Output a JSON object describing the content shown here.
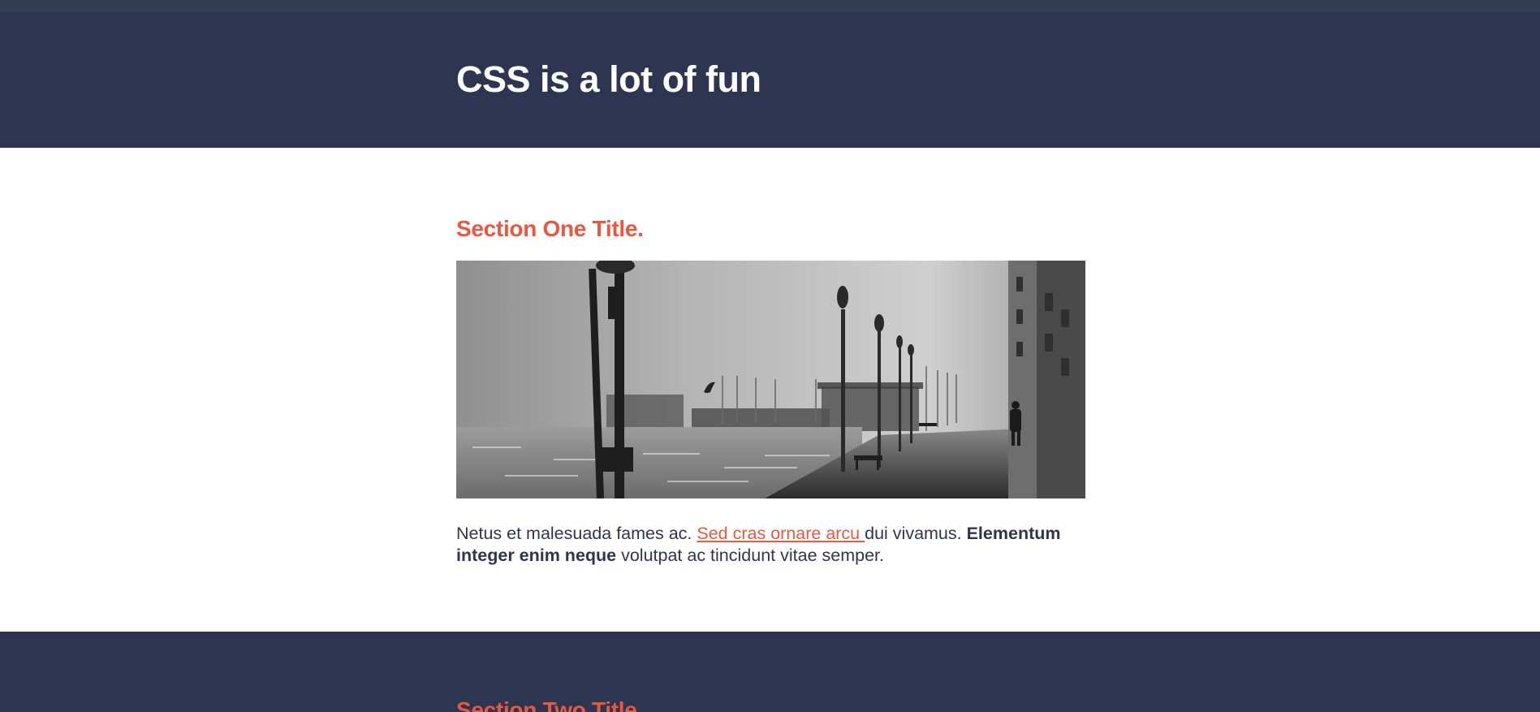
{
  "header": {
    "title": "CSS is a lot of fun"
  },
  "section_one": {
    "title": "Section One Title.",
    "paragraph": {
      "text_before_link": "Netus et malesuada fames ac. ",
      "link_text": "Sed cras ornare arcu ",
      "text_after_link": "dui vivamus. ",
      "bold_text": "Elementum integer enim neque",
      "text_end": " volutpat ac tincidunt vitae semper."
    }
  },
  "section_two": {
    "title": "Section Two Title."
  },
  "colors": {
    "header_bg": "#2e3550",
    "accent": "#e8573e",
    "text": "#2e3550"
  }
}
